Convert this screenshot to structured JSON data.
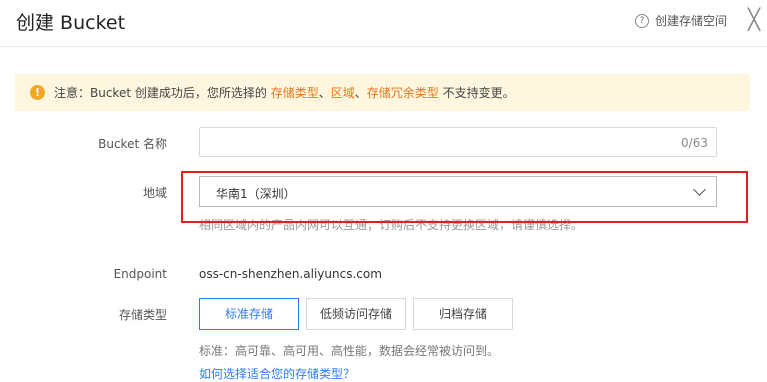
{
  "header": {
    "title": "创建 Bucket",
    "help_label": "创建存储空间",
    "help_icon": "?",
    "close_icon": "╳"
  },
  "notice": {
    "icon": "!",
    "prefix": "注意：Bucket 创建成功后，您所选择的 ",
    "highlight1": "存储类型",
    "sep1": "、",
    "highlight2": "区域",
    "sep2": "、",
    "highlight3": "存储冗余类型",
    "suffix": " 不支持变更。"
  },
  "form": {
    "bucket_name_label": "Bucket 名称",
    "bucket_name_value": "",
    "bucket_name_counter": "0/63",
    "region_label": "地域",
    "region_value": "华南1（深圳）",
    "region_hint": "相同区域内的产品内网可以互通；订购后不支持更换区域，请谨慎选择。",
    "endpoint_label": "Endpoint",
    "endpoint_value": "oss-cn-shenzhen.aliyuncs.com",
    "storage_label": "存储类型",
    "storage_options": [
      "标准存储",
      "低频访问存储",
      "归档存储"
    ],
    "storage_desc": "标准：高可靠、高可用、高性能，数据会经常被访问到。",
    "storage_link": "如何选择适合您的存储类型？"
  },
  "colors": {
    "accent": "#2f7cf6",
    "warning": "#f5a623",
    "highlight_box": "#e02020",
    "notice_bg": "#fff6e0"
  }
}
